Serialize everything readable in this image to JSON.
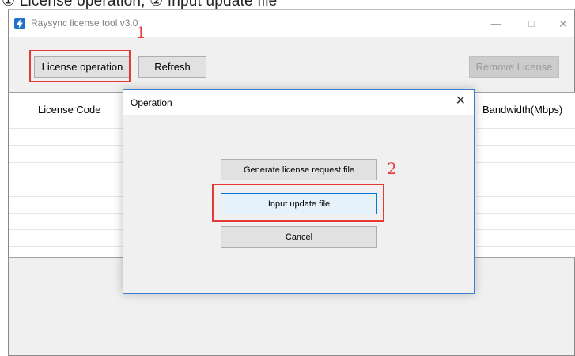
{
  "window": {
    "title": "Raysync license tool v3.0",
    "controls": {
      "minimize": "—",
      "maximize": "□",
      "close": "✕"
    }
  },
  "toolbar": {
    "license_operation": "License operation",
    "refresh": "Refresh",
    "remove_license": "Remove License"
  },
  "table": {
    "columns": [
      "License Code",
      "Bandwidth(Mbps)"
    ],
    "rows": []
  },
  "dialog": {
    "title": "Operation",
    "close": "✕",
    "buttons": {
      "generate": "Generate license request file",
      "input": "Input update file",
      "cancel": "Cancel"
    }
  },
  "annotations": {
    "step1": "1",
    "step2": "2"
  },
  "colors": {
    "annotation": "#e53935",
    "accent": "#0078d7",
    "app_icon": "#1f73c9"
  },
  "icons": {
    "app": "lightning-bolt-icon"
  }
}
